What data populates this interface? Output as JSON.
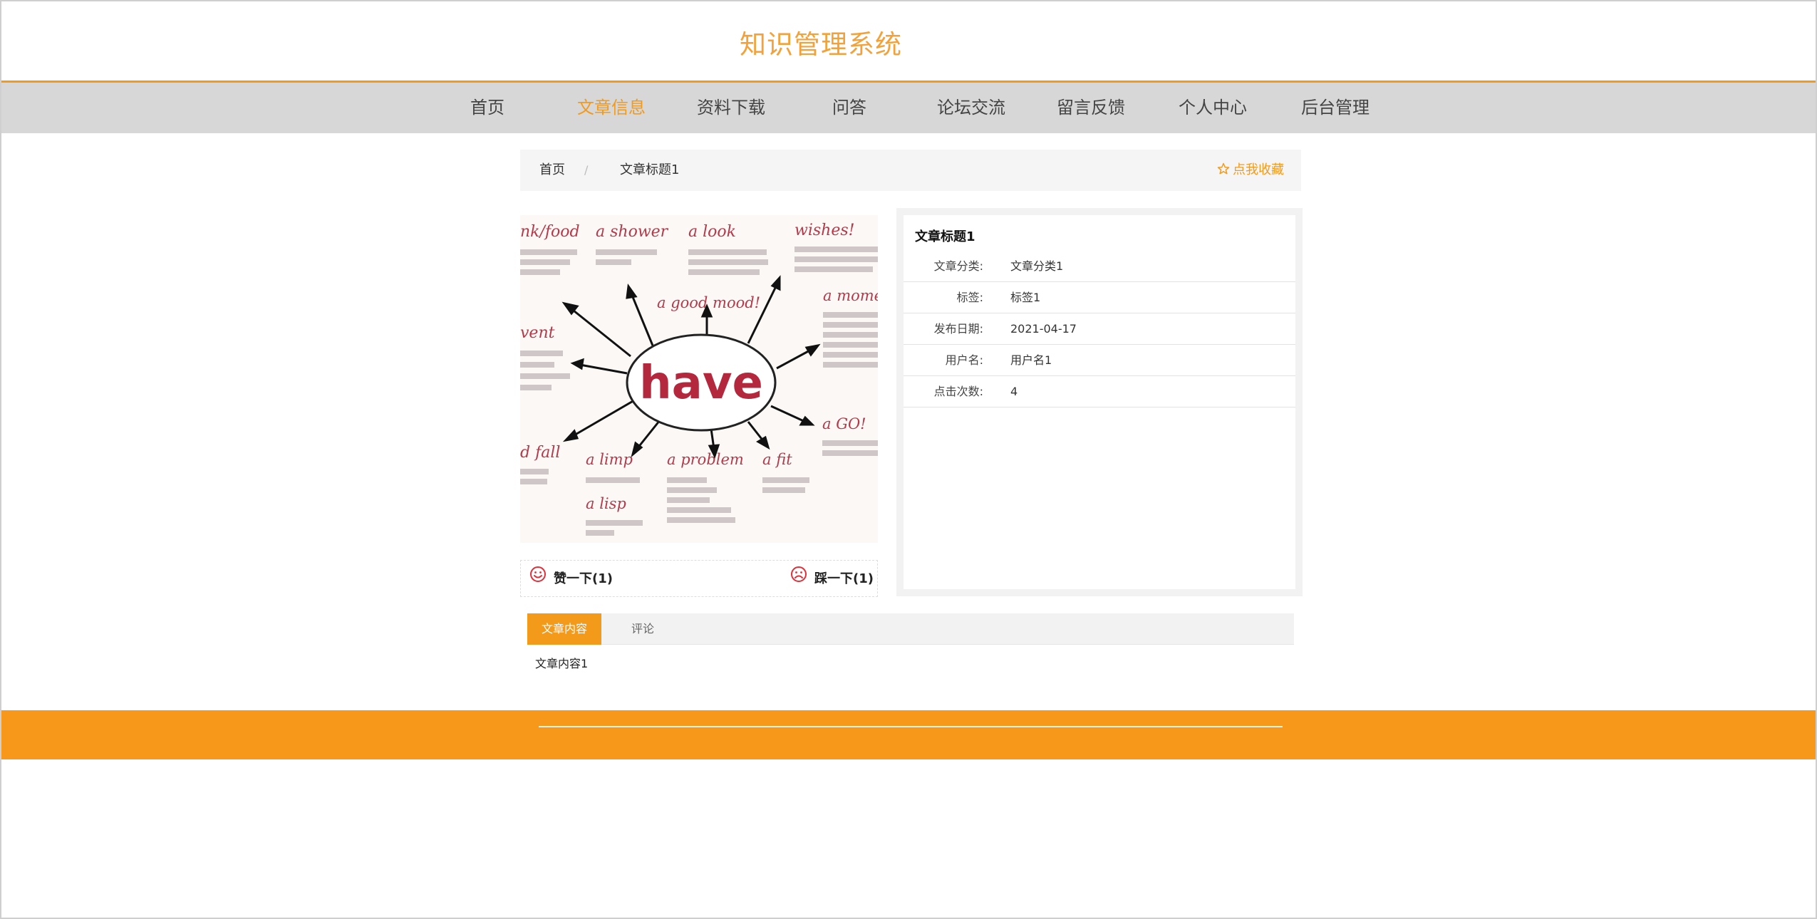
{
  "site": {
    "title": "知识管理系统"
  },
  "nav": {
    "items": [
      {
        "label": "首页",
        "active": false
      },
      {
        "label": "文章信息",
        "active": true
      },
      {
        "label": "资料下载",
        "active": false
      },
      {
        "label": "问答",
        "active": false
      },
      {
        "label": "论坛交流",
        "active": false
      },
      {
        "label": "留言反馈",
        "active": false
      },
      {
        "label": "个人中心",
        "active": false
      },
      {
        "label": "后台管理",
        "active": false
      }
    ]
  },
  "breadcrumb": {
    "home": "首页",
    "separator": "/",
    "current": "文章标题1"
  },
  "favorite": {
    "label": "点我收藏",
    "icon": "star-outline-icon"
  },
  "image": {
    "center_word": "have",
    "labels": [
      "nk/food",
      "a shower",
      "a look",
      "wishes!",
      "a good mood!",
      "a mome",
      "vent",
      "d fall",
      "a limp",
      "a problem",
      "a fit",
      "a GO!",
      "a lisp"
    ]
  },
  "vote": {
    "like": {
      "label": "赞一下(1)",
      "icon": "smile-icon"
    },
    "dislike": {
      "label": "踩一下(1)",
      "icon": "frown-icon"
    }
  },
  "detail": {
    "title": "文章标题1",
    "fields": [
      {
        "label": "文章分类:",
        "value": "文章分类1"
      },
      {
        "label": "标签:",
        "value": "标签1"
      },
      {
        "label": "发布日期:",
        "value": "2021-04-17"
      },
      {
        "label": "用户名:",
        "value": "用户名1"
      },
      {
        "label": "点击次数:",
        "value": "4"
      }
    ]
  },
  "tabs": [
    {
      "label": "文章内容",
      "active": true
    },
    {
      "label": "评论",
      "active": false
    }
  ],
  "content": {
    "text": "文章内容1"
  },
  "colors": {
    "accent": "#f39a1a",
    "nav_bg": "#d7d7d7",
    "footer_bg": "#f7981a",
    "vote_icon": "#e0303a"
  }
}
